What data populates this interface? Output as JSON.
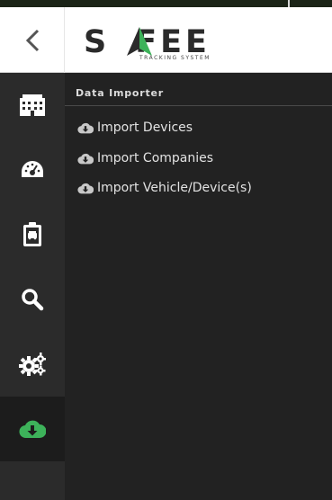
{
  "header": {
    "logo_text_left": "S",
    "logo_text_right": "FEE",
    "logo_tagline": "TRACKING SYSTEM",
    "back_icon": "chevron-left-icon"
  },
  "sidebar": {
    "items": [
      {
        "icon": "building-icon",
        "active": false
      },
      {
        "icon": "dashboard-icon",
        "active": false
      },
      {
        "icon": "clipboard-vehicle-icon",
        "active": false
      },
      {
        "icon": "search-icon",
        "active": false
      },
      {
        "icon": "gears-icon",
        "active": false
      },
      {
        "icon": "cloud-download-icon",
        "active": true
      }
    ]
  },
  "main": {
    "section_title": "Data Importer",
    "links": [
      {
        "label": "Import Devices",
        "icon": "cloud-download-icon"
      },
      {
        "label": "Import Companies",
        "icon": "cloud-download-icon"
      },
      {
        "label": "Import Vehicle/Device(s)",
        "icon": "cloud-download-icon"
      }
    ]
  },
  "colors": {
    "accent_green": "#3db25a",
    "sidebar_bg": "#2b2b2b",
    "content_bg": "#222222"
  }
}
